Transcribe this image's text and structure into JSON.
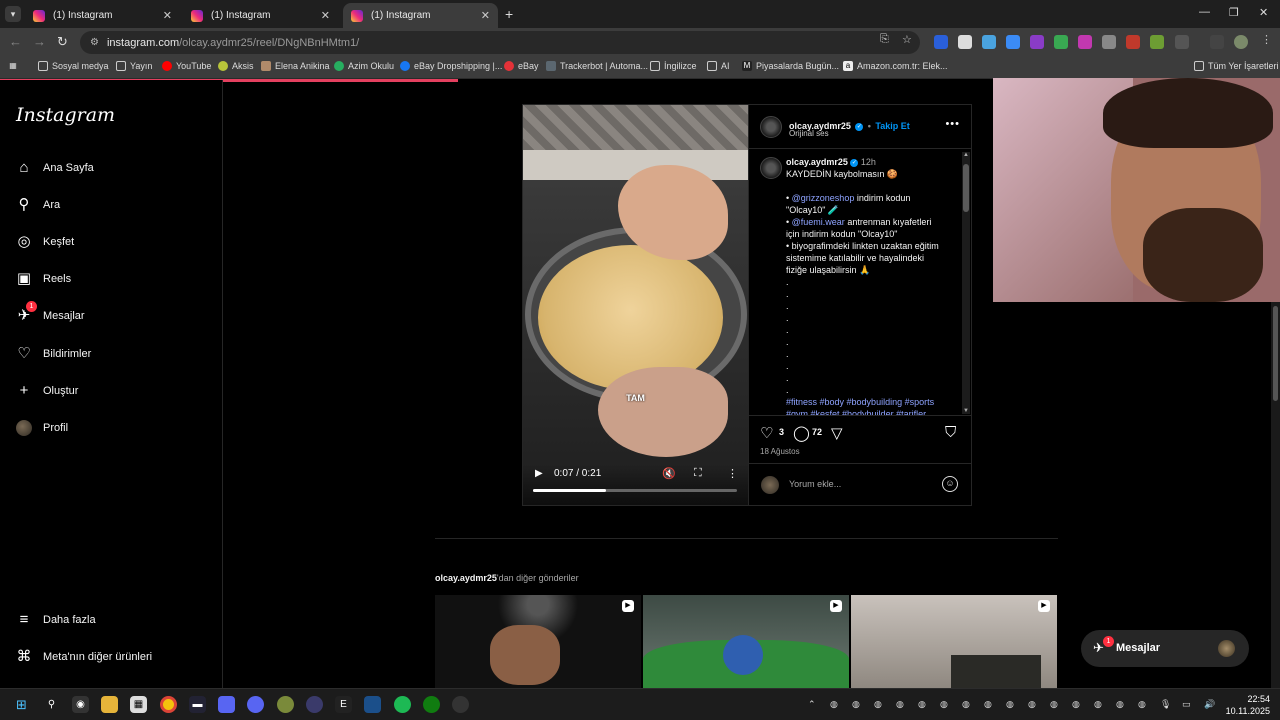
{
  "browser": {
    "tabs": [
      {
        "title": "(1) Instagram",
        "active": false
      },
      {
        "title": "(1) Instagram",
        "active": false
      },
      {
        "title": "(1) Instagram",
        "active": true
      }
    ],
    "url_host": "instagram.com",
    "url_path": "/olcay.aydmr25/reel/DNgNBnHMtm1/",
    "bookmarks": [
      "Sosyal medya",
      "Yayın",
      "YouTube",
      "Aksis",
      "Elena Anikina",
      "Azim Okulu",
      "eBay Dropshipping |...",
      "eBay",
      "Trackerbot | Automa...",
      "İngilizce",
      "AI",
      "Piyasalarda Bugün...",
      "Amazon.com.tr: Elek..."
    ],
    "all_bookmarks": "Tüm Yer İşaretleri"
  },
  "sidebar": {
    "logo": "Instagram",
    "items": [
      {
        "label": "Ana Sayfa",
        "icon": "home-icon"
      },
      {
        "label": "Ara",
        "icon": "search-icon"
      },
      {
        "label": "Keşfet",
        "icon": "compass-icon"
      },
      {
        "label": "Reels",
        "icon": "reels-icon"
      },
      {
        "label": "Mesajlar",
        "icon": "messenger-icon",
        "badge": "1"
      },
      {
        "label": "Bildirimler",
        "icon": "heart-icon"
      },
      {
        "label": "Oluştur",
        "icon": "plus-icon"
      },
      {
        "label": "Profil",
        "icon": "avatar"
      }
    ],
    "bottom": [
      {
        "label": "Daha fazla",
        "icon": "menu-icon"
      },
      {
        "label": "Meta'nın diğer ürünleri",
        "icon": "apps-icon"
      }
    ]
  },
  "post": {
    "username": "olcay.aydmr25",
    "follow": "Takip Et",
    "sep": "•",
    "audio": "Orijinal ses",
    "ago": "12h",
    "video_caption": "TAM",
    "video_time": "0:07 / 0:21",
    "video_progress": 0.36,
    "caption_lines": [
      {
        "text": "KAYDEDİN kaybolmasın 🍪"
      },
      {
        "text": ""
      },
      {
        "text": "• ",
        "mention": "@grizzoneshop",
        "rest": " indirim kodun"
      },
      {
        "text": "\"Olcay10\" 🧪"
      },
      {
        "text": "• ",
        "mention": "@fuemi.wear",
        "rest": " antrenman kıyafetleri"
      },
      {
        "text": "için indirim kodun \"Olcay10\""
      },
      {
        "text": "• biyografimdeki linkten uzaktan eğitim"
      },
      {
        "text": "sistemime katılabilir ve hayalindeki"
      },
      {
        "text": "fiziğe ulaşabilirsin 🙏"
      },
      {
        "text": "."
      },
      {
        "text": "."
      },
      {
        "text": "."
      },
      {
        "text": "."
      },
      {
        "text": "."
      },
      {
        "text": "."
      },
      {
        "text": "."
      },
      {
        "text": "."
      },
      {
        "text": "."
      },
      {
        "text": "."
      }
    ],
    "hashtags_1": "#fitness #body #bodybuilding #sports",
    "hashtags_2": "#gym #keşfet #bodybuilder #tarifler",
    "likes": "3",
    "comments": "72",
    "date": "18 Ağustos",
    "comment_placeholder": "Yorum ekle..."
  },
  "more_posts": {
    "owner": "olcay.aydmr25",
    "suffix": "'dan diğer gönderiler"
  },
  "messages_button": {
    "label": "Mesajlar",
    "badge": "1"
  },
  "taskbar": {
    "time": "22:54",
    "date": "10.11.2025"
  },
  "colors": {
    "accent": "#0095f6",
    "badge": "#ff3040",
    "mention": "#8ea3ff"
  }
}
